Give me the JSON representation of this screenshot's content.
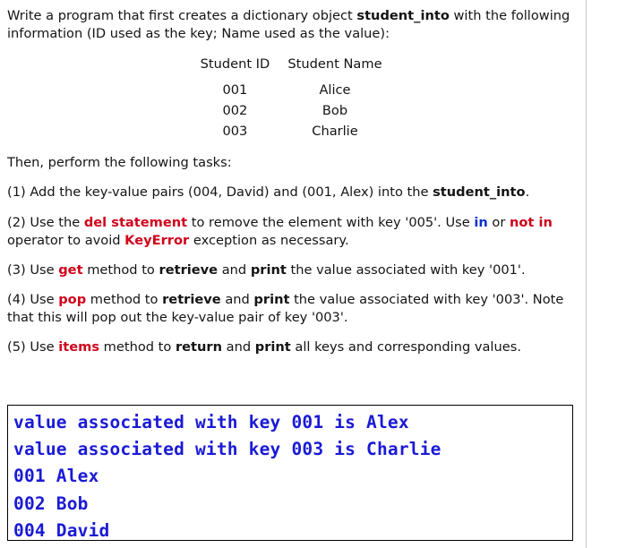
{
  "document": {
    "intro": {
      "part1": "Write a program that first creates a dictionary object ",
      "bold1": "student_into",
      "part2": " with the following information (ID used as the key; Name used as the value):"
    },
    "table": {
      "header_id": "Student ID",
      "header_name": "Student Name",
      "rows": [
        {
          "id": "001",
          "name": "Alice"
        },
        {
          "id": "002",
          "name": "Bob"
        },
        {
          "id": "003",
          "name": "Charlie"
        }
      ]
    },
    "tasks_heading": "Then, perform the following tasks:",
    "tasks": [
      {
        "label": "(1)",
        "seg1": " Add the key-value pairs (004, David) and (001, Alex) into the ",
        "bold1": "student_into",
        "seg2": "."
      },
      {
        "label": "(2)",
        "seg1": " Use the ",
        "kw1": "del statement",
        "seg2": " to remove the element with key '005'. Use ",
        "kw2": "in",
        "seg3": " or ",
        "kw3": "not in",
        "seg4": " operator to avoid ",
        "kw4": "KeyError",
        "seg5": " exception as necessary."
      },
      {
        "label": "(3)",
        "seg1": " Use ",
        "kw1": "get",
        "seg2": " method to ",
        "b1": "retrieve",
        "seg3": " and ",
        "b2": "print",
        "seg4": " the value associated with key '001'."
      },
      {
        "label": "(4)",
        "seg1": " Use ",
        "kw1": "pop",
        "seg2": " method to ",
        "b1": "retrieve",
        "seg3": " and ",
        "b2": "print",
        "seg4": " the value associated with key '003'.  Note that this will pop out the key-value pair of key '003'."
      },
      {
        "label": "(5)",
        "seg1": " Use ",
        "kw1": "items",
        "seg2": " method to ",
        "b1": "return",
        "seg3": " and ",
        "b2": "print",
        "seg4": " all keys and corresponding values."
      }
    ],
    "console_output": [
      "value associated with key 001 is Alex",
      "value associated with key 003 is Charlie",
      "001 Alex",
      "002 Bob",
      "004 David"
    ],
    "colors": {
      "keyword_red": "#d0021b",
      "keyword_blue": "#0033cc",
      "console_text": "#1a1ad6"
    }
  }
}
